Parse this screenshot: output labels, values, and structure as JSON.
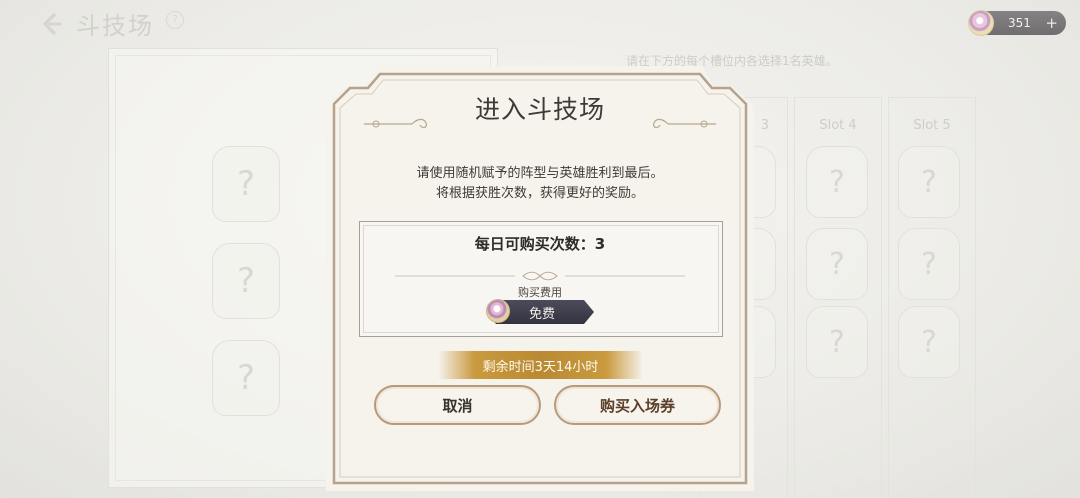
{
  "background": {
    "title": "斗技场",
    "help_glyph": "?",
    "hint": "请在下方的每个槽位内各选择1名英雄。",
    "slots": [
      {
        "label": "3"
      },
      {
        "label": "Slot 4"
      },
      {
        "label": "Slot 5"
      }
    ],
    "card_glyph": "?"
  },
  "currency": {
    "value": "351",
    "plus_glyph": "+",
    "icon": "gem-icon"
  },
  "modal": {
    "title": "进入斗技场",
    "desc_line1": "请使用随机赋予的阵型与英雄胜利到最后。",
    "desc_line2": "将根据获胜次数，获得更好的奖励。",
    "daily_purchase": "每日可购买次数：3",
    "cost_label": "购买费用",
    "cost_value": "免费",
    "time_left": "剩余时间3天14小时",
    "cancel_label": "取消",
    "buy_label": "购买入场券"
  },
  "colors": {
    "accent_gold": "#c99a3e",
    "button_border": "#b89a7a",
    "pill_dark": "#3b3b48"
  }
}
